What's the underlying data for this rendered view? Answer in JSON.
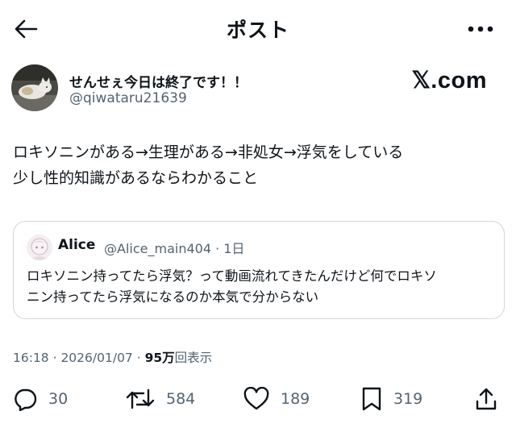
{
  "header": {
    "title": "ポスト",
    "back_icon": "arrow-left-icon",
    "more_icon": "ellipsis-icon"
  },
  "author": {
    "display_name": "せんせぇ今日は終了です！！",
    "handle": "@qiwataru21639",
    "avatar_icon": "cat-photo-avatar"
  },
  "watermark": "𝕏.com",
  "tweet": {
    "lines": [
      "ロキソニンがある→生理がある→非処女→浮気をしている",
      "少し性的知識があるならわかること"
    ]
  },
  "quote": {
    "name": "Alice",
    "meta": "@Alice_main404 · 1日",
    "avatar_icon": "anime-avatar",
    "lines": [
      "ロキソニン持ってたら浮気？って動画流れてきたんだけど何でロキソ",
      "ニン持ってたら浮気になるのか本気で分からない"
    ]
  },
  "meta": {
    "timestamp": "16:18 · 2026/01/07 · ",
    "views_count": "95万",
    "views_label": "回表示"
  },
  "actions": {
    "reply": {
      "icon": "reply-icon",
      "count": "30"
    },
    "repost": {
      "icon": "repost-icon",
      "count": "584"
    },
    "like": {
      "icon": "heart-icon",
      "count": "189"
    },
    "bookmark": {
      "icon": "bookmark-icon",
      "count": "319"
    },
    "share": {
      "icon": "share-icon"
    }
  },
  "colors": {
    "text": "#0f1419",
    "secondary": "#536471",
    "border": "#cfd9de"
  }
}
